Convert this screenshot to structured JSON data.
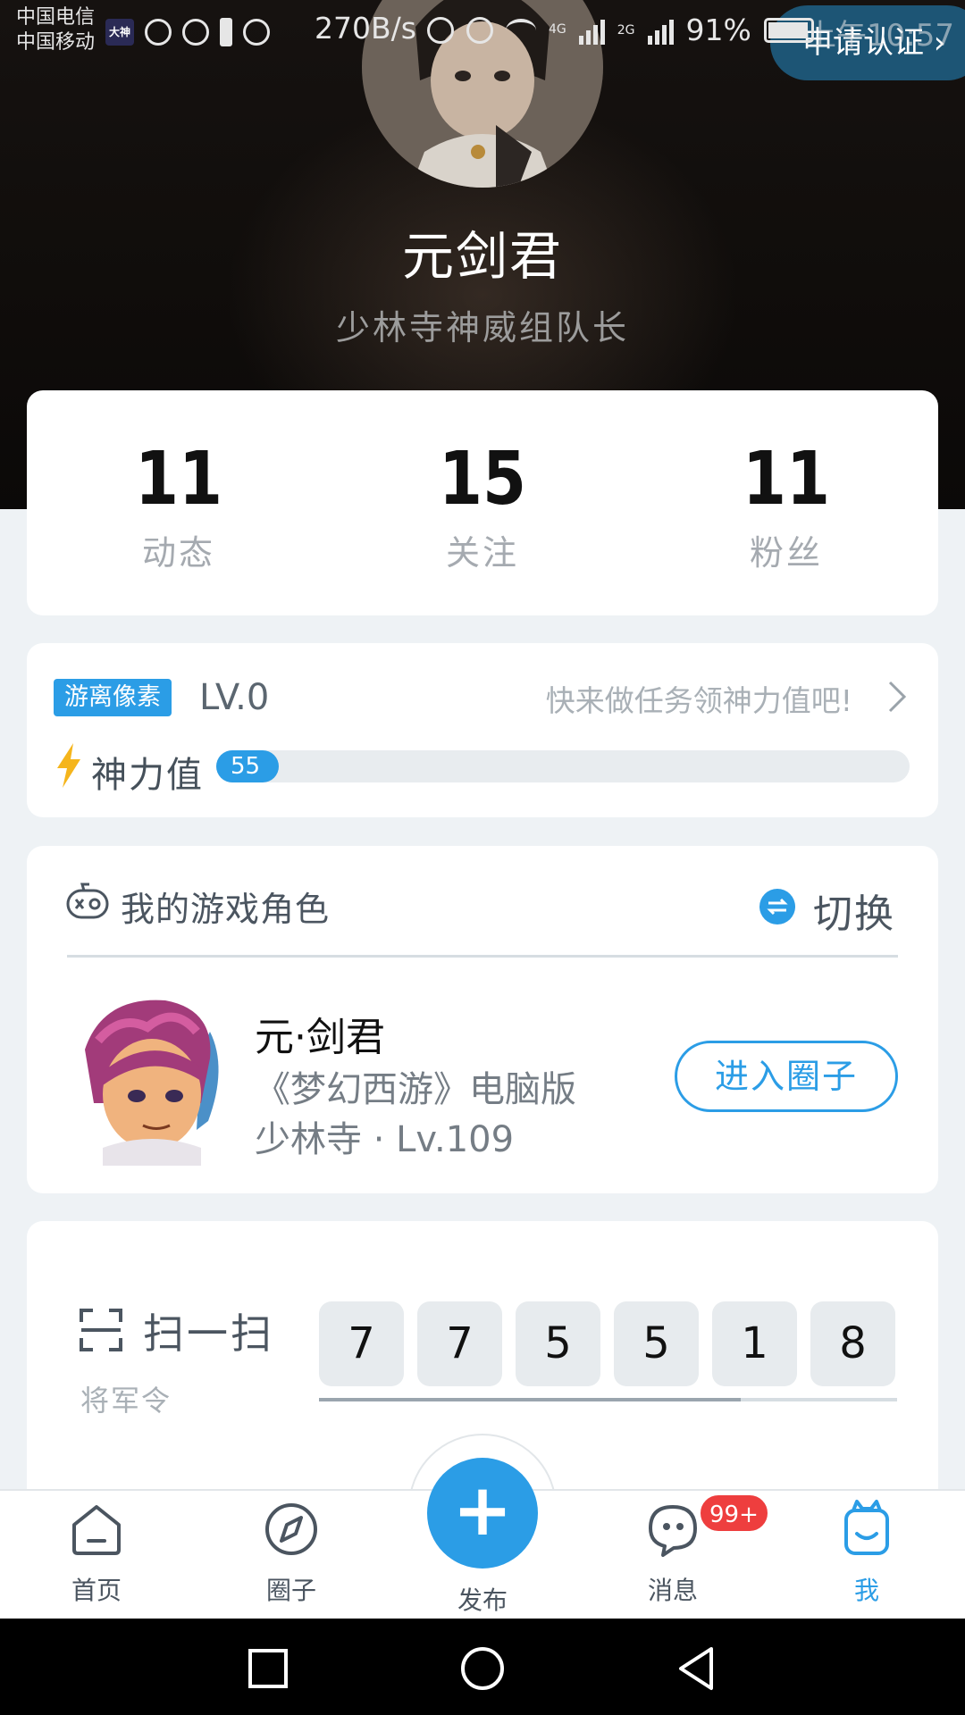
{
  "status_bar": {
    "carrier_1": "中国电信",
    "carrier_2": "中国移动",
    "app_chip": "大神",
    "speed": "270B/s",
    "network_1": "4G",
    "network_2": "2G",
    "battery": "91%",
    "time": "上午10:57"
  },
  "header": {
    "verify_label": "申请认证 ›",
    "name": "元剑君",
    "title": "少林寺神威组队长"
  },
  "stats": [
    {
      "value": "11",
      "label": "动态"
    },
    {
      "value": "15",
      "label": "关注"
    },
    {
      "value": "11",
      "label": "粉丝"
    }
  ],
  "level": {
    "badge": "游离像素",
    "level": "LV.0",
    "hint": "快来做任务领神力值吧!",
    "power_label": "神力值",
    "power_value": "55",
    "power_fraction": 0.0
  },
  "role": {
    "section_title": "我的游戏角色",
    "switch_label": "切换",
    "name": "元·剑君",
    "game": "《梦幻西游》电脑版",
    "school": "少林寺 · Lv.109",
    "enter_label": "进入圈子"
  },
  "scan": {
    "label": "扫一扫",
    "sub": "将军令",
    "digits": [
      "7",
      "7",
      "5",
      "5",
      "1",
      "8"
    ],
    "progress": 0.73
  },
  "nav": {
    "home": "首页",
    "circle": "圈子",
    "publish": "发布",
    "messages": "消息",
    "me": "我",
    "message_badge": "99+"
  },
  "colors": {
    "accent": "#2b9de6",
    "badge_red": "#ee3e3e",
    "bolt": "#f5b51c"
  }
}
